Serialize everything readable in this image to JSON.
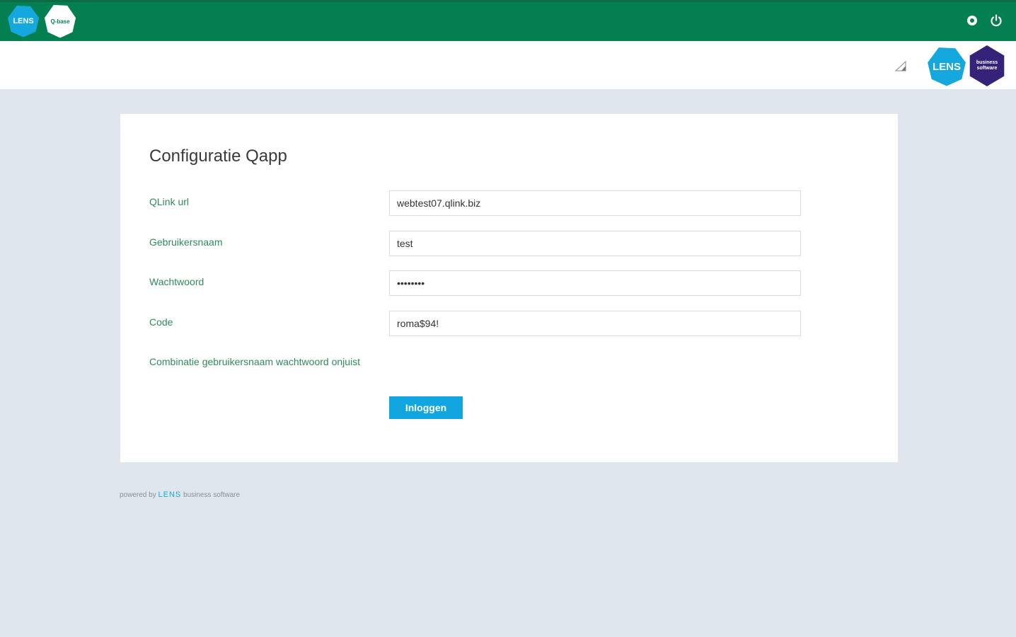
{
  "topbar": {
    "logo_lens_text": "LENS",
    "logo_qbase_text": "Q-base",
    "icons": [
      "settings-icon",
      "power-icon"
    ],
    "bg_color": "#047f4f"
  },
  "subheader": {
    "logo_lens_text": "LENS",
    "logo_business_text": "business software"
  },
  "form": {
    "title": "Configuratie Qapp",
    "fields": [
      {
        "label": "QLink url",
        "value": "webtest07.qlink.biz"
      },
      {
        "label": "Gebruikersnaam",
        "value": "test"
      },
      {
        "label": "Wachtwoord",
        "value": "••••••••"
      },
      {
        "label": "Code",
        "value": "roma$94!"
      }
    ],
    "error": "Combinatie gebruikersnaam wachtwoord onjuist",
    "submit_label": "Inloggen",
    "button_color": "#12a6e1"
  },
  "footer": {
    "powered_by": "powered by",
    "brand": "LENS",
    "suffix": "business software"
  }
}
